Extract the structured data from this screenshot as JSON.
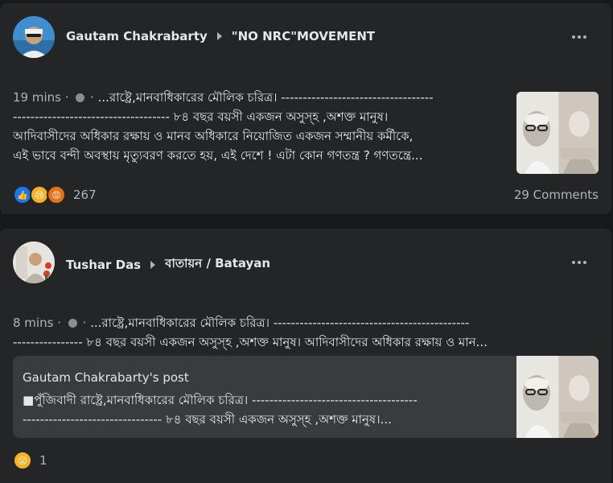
{
  "posts": [
    {
      "author": "Gautam Chakrabarty",
      "group": "\"NO NRC\"MOVEMENT",
      "time": "19 mins",
      "line1": "...রাষ্ট্রে,মানবাধিকারের মৌলিক চরিত্র। -----------------------------------",
      "line2": "------------------------------------ ৮৪ বছর বয়সী একজন অসুস্হ ,অশক্ত মানুষ।",
      "line3": "আদিবাসীদের অধিকার রক্ষায় ও মানব অধিকারে নিয়োজিত একজন সম্মানীয় কর্মীকে,",
      "line4": "এই ভাবে বন্দী অবস্থায় মৃত্যুবরণ করতে হয়, এই দেশে ! এটা কোন গণতন্ত্র ? গণতন্ত্রে...",
      "reaction_count": "267",
      "comments": "29 Comments",
      "reactions": [
        "like",
        "sad",
        "angry"
      ]
    },
    {
      "author": "Tushar Das",
      "group": "বাতায়ন / Batayan",
      "time": "8 mins",
      "line1": "...রাষ্ট্রে,মানবাধিকারের মৌলিক চরিত্র। ---------------------------------------------",
      "line2": "---------------- ৮৪ বছর বয়সী একজন অসুস্হ ,অশক্ত মানুষ। আদিবাসীদের অধিকার রক্ষায় ও মান...",
      "shared_title": "Gautam Chakrabarty's post",
      "shared_line1": "■পুঁজিবাদী রাষ্ট্রে,মানবাধিকারের মৌলিক চরিত্র। --------------------------------------",
      "shared_line2": "-------------------------------- ৮৪ বছর বয়সী একজন অসুস্হ ,অশক্ত মানুষ।...",
      "reaction_count": "1",
      "reactions": [
        "wow"
      ]
    }
  ],
  "colors": {
    "background": "#18191a",
    "card": "#242526",
    "shared_card": "#3a3b3c",
    "like": "#1877f2",
    "sad": "#f7b125",
    "angry": "#e9710f"
  }
}
